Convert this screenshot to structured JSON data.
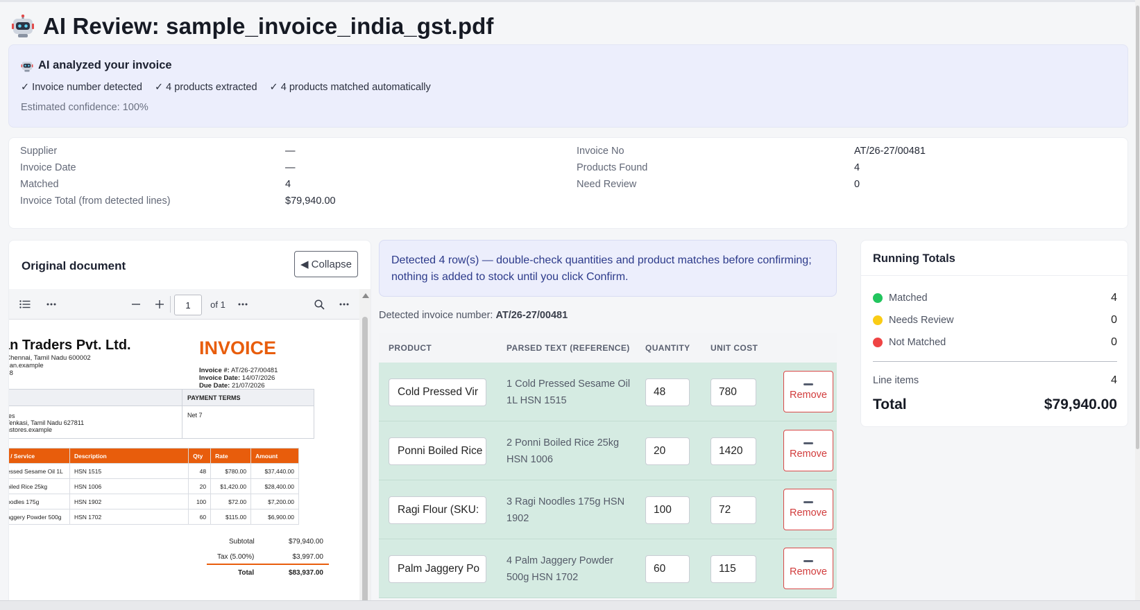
{
  "header": {
    "title": "AI Review: sample_invoice_india_gst.pdf"
  },
  "ai_box": {
    "heading": "AI analyzed your invoice",
    "checks": [
      "✓ Invoice number detected",
      "✓ 4 products extracted",
      "✓ 4 products matched automatically"
    ],
    "confidence": "Estimated confidence: 100%"
  },
  "summary": {
    "supplier_label": "Supplier",
    "supplier_value": "—",
    "invoice_date_label": "Invoice Date",
    "invoice_date_value": "—",
    "matched_label": "Matched",
    "matched_value": "4",
    "invoice_total_label": "Invoice Total (from detected lines)",
    "invoice_total_value": "$79,940.00",
    "invoice_no_label": "Invoice No",
    "invoice_no_value": "AT/26-27/00481",
    "products_found_label": "Products Found",
    "products_found_value": "4",
    "need_review_label": "Need Review",
    "need_review_value": "0"
  },
  "doc_panel": {
    "title": "Original document",
    "collapse_label": "◀ Collapse",
    "toolbar": {
      "page_value": "1",
      "page_of": "of 1"
    },
    "pdf": {
      "company": "an Traders Pvt. Ltd.",
      "addr1": ", Chennai, Tamil Nadu 600002",
      "addr2": "ohan.example",
      "addr3": "288",
      "invoice_title": "INVOICE",
      "inv_no_label": "Invoice #:",
      "inv_no": " AT/26-27/00481",
      "inv_date_label": "Invoice Date:",
      "inv_date": " 14/07/2026",
      "due_date_label": "Due Date:",
      "due_date": " 21/07/2026",
      "payment_terms_label": "PAYMENT TERMS",
      "net": "Net 7",
      "bill1": "ores",
      "bill2": ", Tenkasi, Tamil Nadu 627811",
      "bill3": "anstores.example",
      "columns": [
        "t / Service",
        "Description",
        "Qty",
        "Rate",
        "Amount"
      ],
      "rows": [
        [
          "essed Sesame Oil 1L",
          "HSN 1515",
          "48",
          "$780.00",
          "$37,440.00"
        ],
        [
          "oiled Rice 25kg",
          "HSN 1006",
          "20",
          "$1,420.00",
          "$28,400.00"
        ],
        [
          "oodles 175g",
          "HSN 1902",
          "100",
          "$72.00",
          "$7,200.00"
        ],
        [
          "aggery Powder 500g",
          "HSN 1702",
          "60",
          "$115.00",
          "$6,900.00"
        ]
      ],
      "subtotal_label": "Subtotal",
      "subtotal": "$79,940.00",
      "tax_label": "Tax (5.00%)",
      "tax": "$3,997.00",
      "total_label": "Total",
      "total": "$83,937.00"
    }
  },
  "notice": "Detected 4 row(s) — double-check quantities and product matches before confirming; nothing is added to stock until you click Confirm.",
  "detected": {
    "label": "Detected invoice number:",
    "value": "AT/26-27/00481"
  },
  "grid": {
    "columns": [
      "PRODUCT",
      "PARSED TEXT (REFERENCE)",
      "QUANTITY",
      "UNIT COST"
    ],
    "remove_label": "Remove",
    "rows": [
      {
        "product": "Cold Pressed Vir",
        "parsed": "1 Cold Pressed Sesame Oil 1L HSN 1515",
        "qty": "48",
        "cost": "780"
      },
      {
        "product": "Ponni Boiled Rice",
        "parsed": "2 Ponni Boiled Rice 25kg HSN 1006",
        "qty": "20",
        "cost": "1420"
      },
      {
        "product": "Ragi Flour (SKU:",
        "parsed": "3 Ragi Noodles 175g HSN 1902",
        "qty": "100",
        "cost": "72"
      },
      {
        "product": "Palm Jaggery Po",
        "parsed": "4 Palm Jaggery Powder 500g HSN 1702",
        "qty": "60",
        "cost": "115"
      }
    ]
  },
  "totals": {
    "title": "Running Totals",
    "matched_label": "Matched",
    "matched": "4",
    "matched_color": "#22c55e",
    "review_label": "Needs Review",
    "review": "0",
    "review_color": "#facc15",
    "not_label": "Not Matched",
    "not": "0",
    "not_color": "#ef4444",
    "line_items_label": "Line items",
    "line_items": "4",
    "total_label": "Total",
    "total": "$79,940.00"
  },
  "icons": {
    "robot": "robot-icon",
    "list": "list-icon",
    "more": "more-icon",
    "zoom_out": "minus-icon",
    "zoom_in": "plus-icon",
    "search": "search-icon"
  }
}
